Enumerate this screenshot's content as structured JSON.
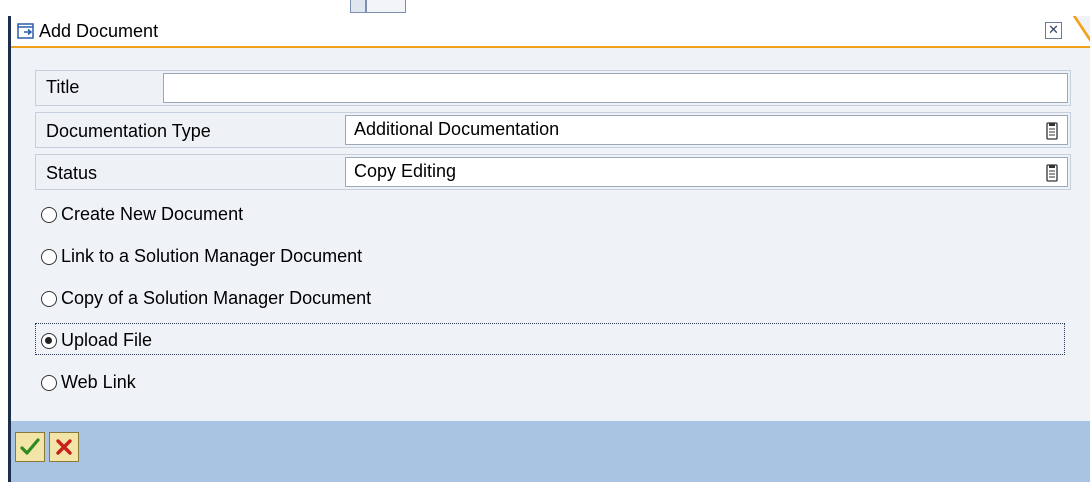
{
  "dialog": {
    "title": "Add Document",
    "close_icon": "close-icon"
  },
  "fields": {
    "title": {
      "label": "Title",
      "value": ""
    },
    "doc_type": {
      "label": "Documentation Type",
      "value": "Additional Documentation"
    },
    "status": {
      "label": "Status",
      "value": "Copy Editing"
    }
  },
  "options": [
    {
      "label": "Create New Document",
      "selected": false
    },
    {
      "label": "Link to a Solution Manager Document",
      "selected": false
    },
    {
      "label": "Copy of a Solution Manager Document",
      "selected": false
    },
    {
      "label": "Upload File",
      "selected": true
    },
    {
      "label": "Web Link",
      "selected": false
    }
  ],
  "footer": {
    "confirm_icon": "checkmark-icon",
    "cancel_icon": "cancel-icon"
  },
  "colors": {
    "accent": "#f0a11c",
    "footer_bg": "#a9c3e3",
    "dialog_bg": "#eff3f8"
  }
}
